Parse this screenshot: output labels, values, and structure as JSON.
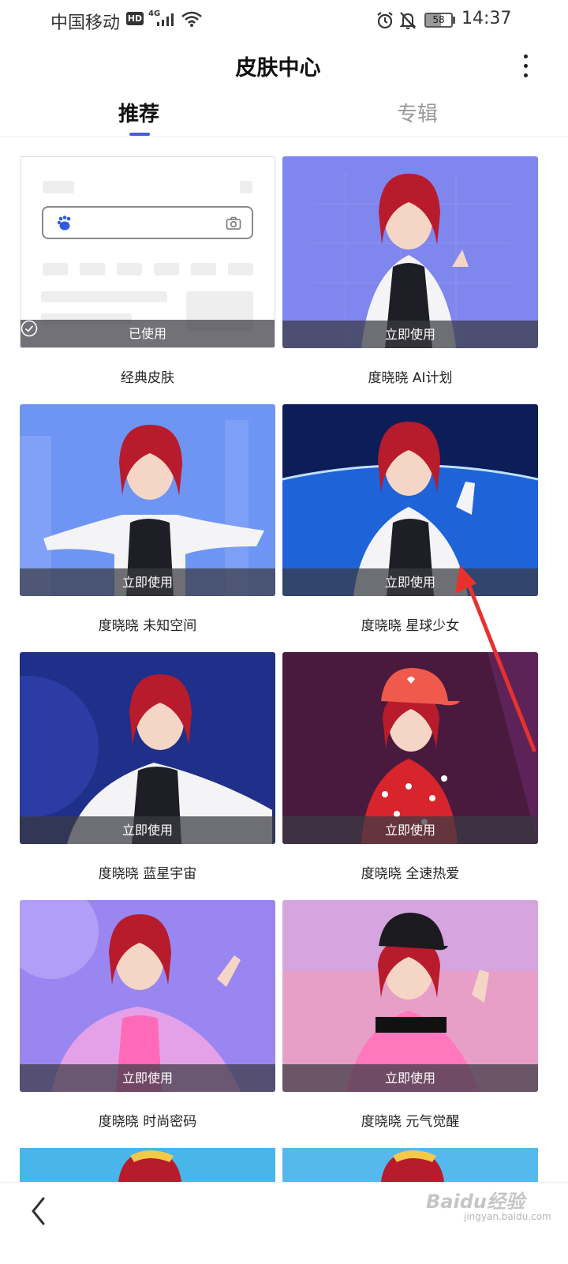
{
  "status_bar": {
    "carrier": "中国移动",
    "hd": "HD",
    "network": "4G",
    "battery": "58",
    "battery_level": 0.58,
    "time": "14:37"
  },
  "header": {
    "title": "皮肤中心",
    "more_icon": "more-vertical-icon"
  },
  "tabs": [
    {
      "label": "推荐",
      "active": true
    },
    {
      "label": "专辑",
      "active": false
    }
  ],
  "skins": [
    {
      "title": "经典皮肤",
      "action": "已使用",
      "used": true,
      "bg": "#ffffff"
    },
    {
      "title": "度晓晓 AI计划",
      "action": "立即使用",
      "used": false,
      "bg": "#7f86ee"
    },
    {
      "title": "度晓晓 未知空间",
      "action": "立即使用",
      "used": false,
      "bg": "#6f95f4"
    },
    {
      "title": "度晓晓 星球少女",
      "action": "立即使用",
      "used": false,
      "bg": "#0d1d58"
    },
    {
      "title": "度晓晓 蓝星宇宙",
      "action": "立即使用",
      "used": false,
      "bg": "#1f2f8a"
    },
    {
      "title": "度晓晓 全速热爱",
      "action": "立即使用",
      "used": false,
      "bg": "#4a1a3e"
    },
    {
      "title": "度晓晓 时尚密码",
      "action": "立即使用",
      "used": false,
      "bg": "#9a86f0"
    },
    {
      "title": "度晓晓 元气觉醒",
      "action": "立即使用",
      "used": false,
      "bg": "#e79fc7"
    }
  ],
  "bottom": {
    "back_icon": "chevron-left-icon"
  },
  "watermark": {
    "text": "Baidu经验",
    "sub": "jingyan.baidu.com"
  }
}
